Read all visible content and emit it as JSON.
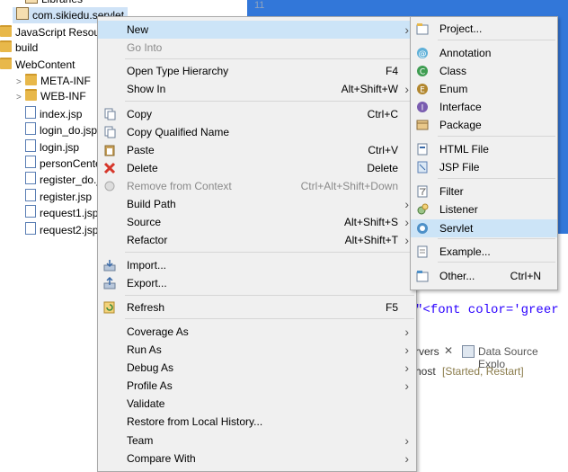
{
  "explorer": {
    "items": [
      {
        "label": "Libraries",
        "indent": 1,
        "icon": "library-icon",
        "arrow": ""
      },
      {
        "label": "com.sikiedu.servlet",
        "indent": 1,
        "icon": "package-icon",
        "arrow": "",
        "selected": true
      },
      {
        "label": "JavaScript Resou",
        "indent": 0,
        "icon": "javascript-resources-icon",
        "arrow": ""
      },
      {
        "label": "build",
        "indent": 0,
        "icon": "folder-icon",
        "arrow": ""
      },
      {
        "label": "WebContent",
        "indent": 0,
        "icon": "folder-icon",
        "arrow": ""
      },
      {
        "label": "META-INF",
        "indent": 1,
        "icon": "folder-icon",
        "arrow": ">"
      },
      {
        "label": "WEB-INF",
        "indent": 1,
        "icon": "folder-icon",
        "arrow": ">"
      },
      {
        "label": "index.jsp",
        "indent": 1,
        "icon": "jsp-file-icon",
        "arrow": ""
      },
      {
        "label": "login_do.jsp",
        "indent": 1,
        "icon": "jsp-file-icon",
        "arrow": ""
      },
      {
        "label": "login.jsp",
        "indent": 1,
        "icon": "jsp-file-icon",
        "arrow": ""
      },
      {
        "label": "personCenter",
        "indent": 1,
        "icon": "jsp-file-icon",
        "arrow": ""
      },
      {
        "label": "register_do.jsp",
        "indent": 1,
        "icon": "jsp-file-icon",
        "arrow": ""
      },
      {
        "label": "register.jsp",
        "indent": 1,
        "icon": "jsp-file-icon",
        "arrow": ""
      },
      {
        "label": "request1.jsp",
        "indent": 1,
        "icon": "jsp-file-icon",
        "arrow": ""
      },
      {
        "label": "request2.jsp",
        "indent": 1,
        "icon": "jsp-file-icon",
        "arrow": ""
      }
    ]
  },
  "editor": {
    "line_number": "11",
    "code_fragment": "\"<font color='greer",
    "server_tab": "rvers",
    "datasource_tab": "Data Source Explo",
    "server_status_host": "host",
    "server_status": "[Started, Restart]"
  },
  "context_menu": {
    "items": [
      {
        "label": "New",
        "key": "",
        "submenu": true,
        "highlight": true,
        "icon": ""
      },
      {
        "label": "Go Into",
        "key": "",
        "disabled": true,
        "icon": ""
      },
      {
        "sep": true
      },
      {
        "label": "Open Type Hierarchy",
        "key": "F4",
        "icon": ""
      },
      {
        "label": "Show In",
        "key": "Alt+Shift+W",
        "submenu": true,
        "icon": ""
      },
      {
        "sep": true
      },
      {
        "label": "Copy",
        "key": "Ctrl+C",
        "icon": "copy-icon"
      },
      {
        "label": "Copy Qualified Name",
        "key": "",
        "icon": "copy-qualified-icon"
      },
      {
        "label": "Paste",
        "key": "Ctrl+V",
        "icon": "paste-icon"
      },
      {
        "label": "Delete",
        "key": "Delete",
        "icon": "delete-icon"
      },
      {
        "label": "Remove from Context",
        "key": "Ctrl+Alt+Shift+Down",
        "disabled": true,
        "icon": "remove-context-icon"
      },
      {
        "label": "Build Path",
        "key": "",
        "submenu": true,
        "icon": ""
      },
      {
        "label": "Source",
        "key": "Alt+Shift+S",
        "submenu": true,
        "icon": ""
      },
      {
        "label": "Refactor",
        "key": "Alt+Shift+T",
        "submenu": true,
        "icon": ""
      },
      {
        "sep": true
      },
      {
        "label": "Import...",
        "key": "",
        "icon": "import-icon"
      },
      {
        "label": "Export...",
        "key": "",
        "icon": "export-icon"
      },
      {
        "sep": true
      },
      {
        "label": "Refresh",
        "key": "F5",
        "icon": "refresh-icon"
      },
      {
        "sep": true
      },
      {
        "label": "Coverage As",
        "key": "",
        "submenu": true,
        "icon": ""
      },
      {
        "label": "Run As",
        "key": "",
        "submenu": true,
        "icon": ""
      },
      {
        "label": "Debug As",
        "key": "",
        "submenu": true,
        "icon": ""
      },
      {
        "label": "Profile As",
        "key": "",
        "submenu": true,
        "icon": ""
      },
      {
        "label": "Validate",
        "key": "",
        "icon": ""
      },
      {
        "label": "Restore from Local History...",
        "key": "",
        "icon": ""
      },
      {
        "label": "Team",
        "key": "",
        "submenu": true,
        "icon": ""
      },
      {
        "label": "Compare With",
        "key": "",
        "submenu": true,
        "icon": ""
      }
    ]
  },
  "new_submenu": {
    "items": [
      {
        "label": "Project...",
        "key": "",
        "icon": "project-icon"
      },
      {
        "sep": true
      },
      {
        "label": "Annotation",
        "key": "",
        "icon": "annotation-icon"
      },
      {
        "label": "Class",
        "key": "",
        "icon": "class-icon"
      },
      {
        "label": "Enum",
        "key": "",
        "icon": "enum-icon"
      },
      {
        "label": "Interface",
        "key": "",
        "icon": "interface-icon"
      },
      {
        "label": "Package",
        "key": "",
        "icon": "package-icon"
      },
      {
        "sep": true
      },
      {
        "label": "HTML File",
        "key": "",
        "icon": "html-file-icon"
      },
      {
        "label": "JSP File",
        "key": "",
        "icon": "jsp-file-icon"
      },
      {
        "sep": true
      },
      {
        "label": "Filter",
        "key": "",
        "icon": "filter-icon"
      },
      {
        "label": "Listener",
        "key": "",
        "icon": "listener-icon"
      },
      {
        "label": "Servlet",
        "key": "",
        "icon": "servlet-icon",
        "highlight": true
      },
      {
        "sep": true
      },
      {
        "label": "Example...",
        "key": "",
        "icon": "example-icon"
      },
      {
        "sep": true
      },
      {
        "label": "Other...",
        "key": "Ctrl+N",
        "icon": "other-icon"
      }
    ]
  },
  "colors": {
    "selection_blue": "#3277d9",
    "menu_bg": "#f0f0f0",
    "menu_highlight": "#cce4f7"
  }
}
